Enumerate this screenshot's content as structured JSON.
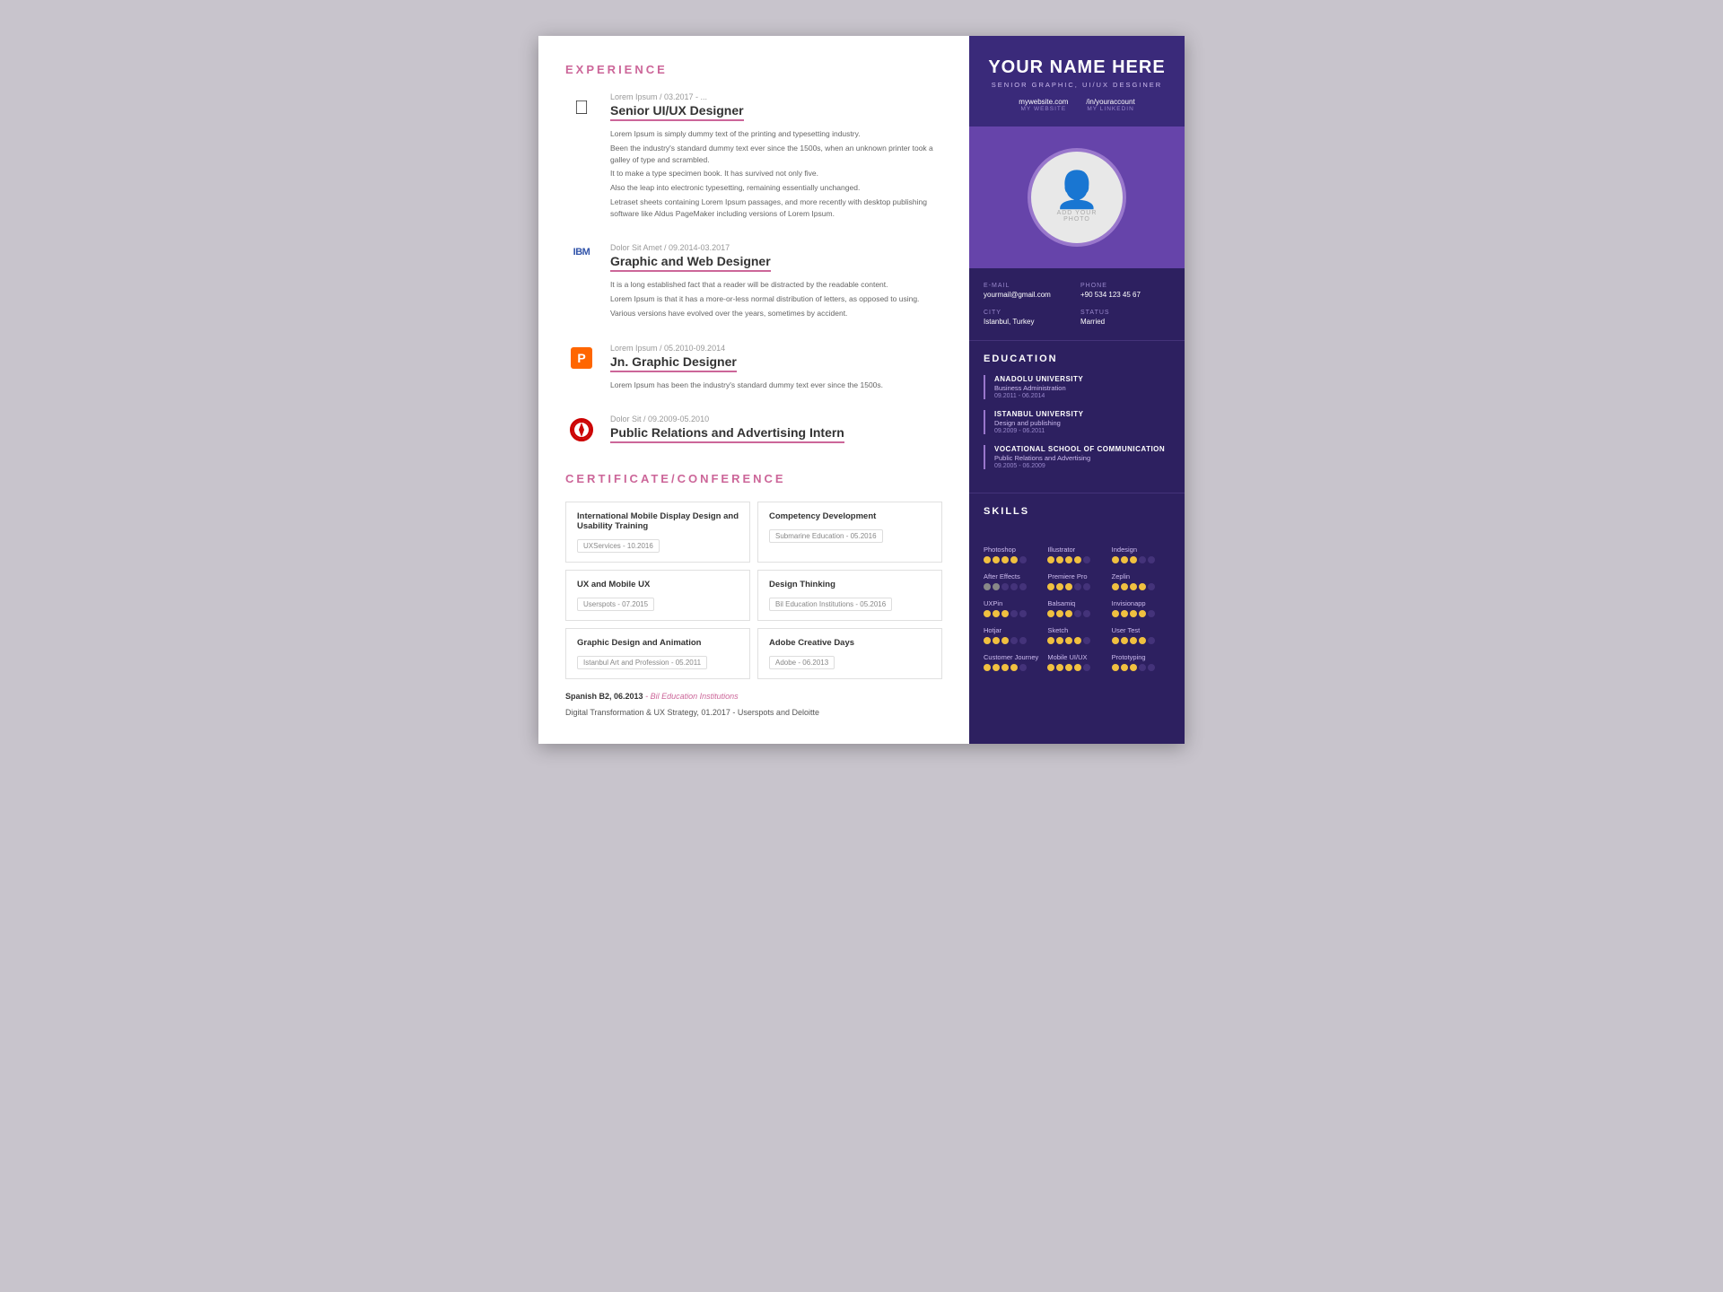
{
  "left": {
    "experience_title": "EXPERIENCE",
    "jobs": [
      {
        "id": "job-apple",
        "logo_type": "apple",
        "meta": "Lorem Ipsum / 03.2017 - ...",
        "title": "Senior UI/UX Designer",
        "desc": [
          "Lorem Ipsum is simply dummy text of the printing and typesetting industry.",
          "Been the industry's standard dummy text ever since the 1500s, when an unknown printer took a galley of type and scrambled.",
          "It to make a type specimen book. It has survived not only five.",
          "Also the leap into electronic typesetting, remaining essentially unchanged.",
          "Letraset sheets containing Lorem Ipsum passages, and more recently with desktop publishing software like Aldus PageMaker including versions of Lorem Ipsum."
        ]
      },
      {
        "id": "job-ibm",
        "logo_type": "ibm",
        "meta": "Dolor Sit Amet / 09.2014-03.2017",
        "title": "Graphic and Web Designer",
        "desc": [
          "It is a long established fact that a reader will be distracted by the readable content.",
          "Lorem Ipsum is that it has a more-or-less normal distribution of letters, as opposed to using.",
          "Various versions have evolved over the years, sometimes by accident."
        ]
      },
      {
        "id": "job-payoneer",
        "logo_type": "p",
        "meta": "Lorem Ipsum / 05.2010-09.2014",
        "title": "Jn. Graphic Designer",
        "desc": [
          "Lorem Ipsum has been the industry's standard dummy text ever since the 1500s."
        ]
      },
      {
        "id": "job-airline",
        "logo_type": "airline",
        "meta": "Dolor Sit / 09.2009-05.2010",
        "title": "Public Relations and Advertising Intern",
        "desc": []
      }
    ],
    "cert_title": "CERTIFICATE/CONFERENCE",
    "certificates": [
      {
        "name": "International Mobile Display Design and Usability Training",
        "badge": "UXServices - 10.2016"
      },
      {
        "name": "Competency Development",
        "badge": "Submarine Education - 05.2016"
      },
      {
        "name": "UX and Mobile UX",
        "badge": "Userspots - 07.2015"
      },
      {
        "name": "Design Thinking",
        "badge": "Bil Education Institutions - 05.2016"
      },
      {
        "name": "Graphic Design and Animation",
        "badge": "Istanbul Art and Profession - 05.2011"
      },
      {
        "name": "Adobe Creative Days",
        "badge": "Adobe - 06.2013"
      }
    ],
    "language": {
      "label": "Spanish B2, 06.2013",
      "institution": "Bil Education Institutions"
    },
    "digital": "Digital Transformation & UX Strategy, 01.2017 - Userspots and Deloitte"
  },
  "right": {
    "name": "YOUR NAME HERE",
    "subtitle": "SENIOR GRAPHIC, UI/UX DESGINER",
    "website_url": "mywebsite.com",
    "website_label": "MY WEBSITE",
    "linkedin_url": "/in/youraccount",
    "linkedin_label": "MY LINKEDIN",
    "photo_label": "ADD YOUR\nPHOTO",
    "email_label": "E-MAIL",
    "email_value": "yourmail@gmail.com",
    "phone_label": "PHONE",
    "phone_value": "+90 534 123 45 67",
    "city_label": "CITY",
    "city_value": "Istanbul, Turkey",
    "status_label": "STATUS",
    "status_value": "Married",
    "education_title": "EDUCATION",
    "education": [
      {
        "school": "ANADOLU UNIVERSITY",
        "degree": "Business Administration",
        "years": "09.2011 - 06.2014"
      },
      {
        "school": "ISTANBUL UNIVERSITY",
        "degree": "Design and publishing",
        "years": "09.2009 - 06.2011"
      },
      {
        "school": "VOCATIONAL SCHOOL OF COMMUNICATION",
        "degree": "Public Relations and Advertising",
        "years": "09.2005 - 06.2009"
      }
    ],
    "skills_title": "SKILLS",
    "skills": [
      {
        "name": "Photoshop",
        "filled": 4,
        "total": 5,
        "color": "yellow"
      },
      {
        "name": "Illustrator",
        "filled": 4,
        "total": 5,
        "color": "yellow"
      },
      {
        "name": "Indesign",
        "filled": 3,
        "total": 5,
        "color": "yellow"
      },
      {
        "name": "After Effects",
        "filled": 2,
        "total": 5,
        "color": "grey"
      },
      {
        "name": "Premiere Pro",
        "filled": 3,
        "total": 5,
        "color": "yellow"
      },
      {
        "name": "Zeplin",
        "filled": 4,
        "total": 5,
        "color": "yellow"
      },
      {
        "name": "UXPin",
        "filled": 3,
        "total": 5,
        "color": "yellow"
      },
      {
        "name": "Balsamiq",
        "filled": 3,
        "total": 5,
        "color": "yellow"
      },
      {
        "name": "Invisionapp",
        "filled": 4,
        "total": 5,
        "color": "yellow"
      },
      {
        "name": "Hotjar",
        "filled": 3,
        "total": 5,
        "color": "yellow"
      },
      {
        "name": "Sketch",
        "filled": 4,
        "total": 5,
        "color": "yellow"
      },
      {
        "name": "User Test",
        "filled": 4,
        "total": 5,
        "color": "yellow"
      },
      {
        "name": "Customer Journey",
        "filled": 4,
        "total": 5,
        "color": "yellow"
      },
      {
        "name": "Mobile UI/UX",
        "filled": 4,
        "total": 5,
        "color": "yellow"
      },
      {
        "name": "Prototyping",
        "filled": 3,
        "total": 5,
        "color": "yellow"
      }
    ]
  }
}
